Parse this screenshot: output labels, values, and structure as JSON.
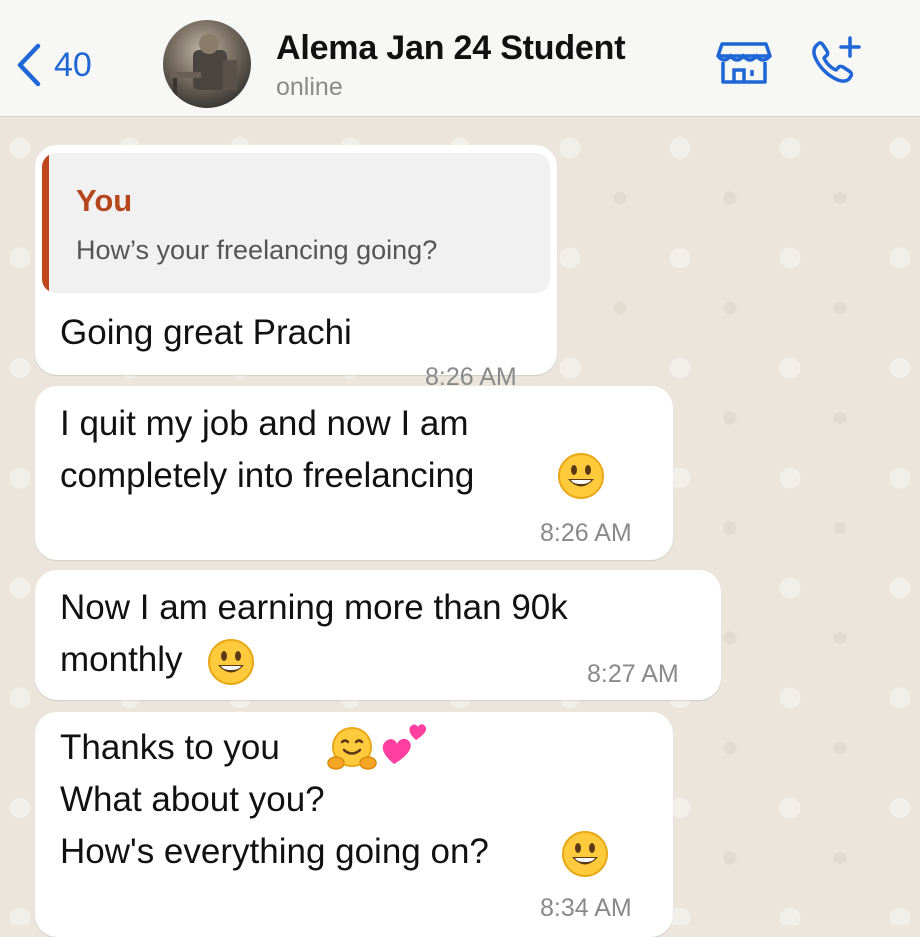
{
  "header": {
    "back_count": "40",
    "contact_name": "Alema Jan 24 Student",
    "status": "online",
    "icons": [
      "chevron-left-icon",
      "store-icon",
      "add-call-icon"
    ]
  },
  "colors": {
    "accent": "#1f66d6",
    "quote_author": "#b6461d",
    "bubble": "#ffffff",
    "chat_bg": "#ebe5dc"
  },
  "messages": [
    {
      "quoted": {
        "author": "You",
        "text": "How’s your freelancing going?"
      },
      "lines": [
        "Going great Prachi"
      ],
      "time": "8:26 AM"
    },
    {
      "lines": [
        "I quit my job and now I am",
        "completely into freelancing"
      ],
      "emojis": [
        "grinning-face-emoji"
      ],
      "time": "8:26 AM"
    },
    {
      "lines": [
        "Now I am earning more than 90k",
        "monthly"
      ],
      "emojis": [
        "grinning-face-emoji"
      ],
      "time": "8:27 AM"
    },
    {
      "lines": [
        "Thanks to you",
        "What about you?",
        "How's everything going on?"
      ],
      "emojis": [
        "hugging-face-emoji",
        "two-hearts-emoji",
        "grinning-face-emoji"
      ],
      "time": "8:34 AM"
    }
  ]
}
